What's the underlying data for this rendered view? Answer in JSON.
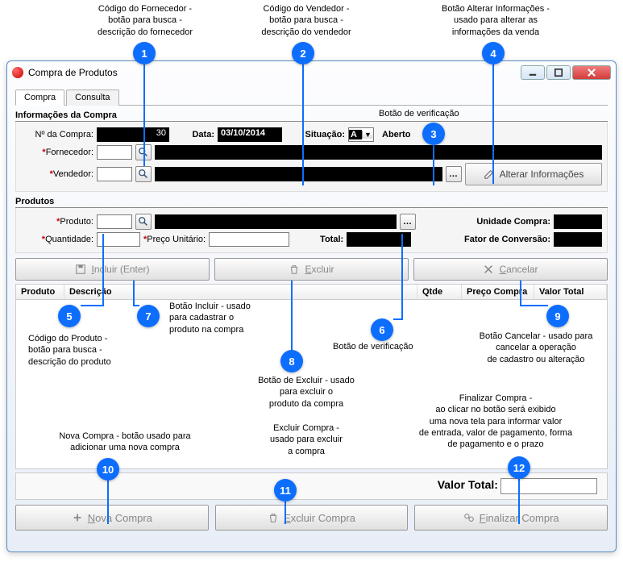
{
  "annotations": {
    "a1": {
      "num": "1",
      "text": "Código do Fornecedor -\nbotão para busca -\ndescrição do fornecedor"
    },
    "a2": {
      "num": "2",
      "text": "Código do Vendedor -\nbotão para busca -\ndescrição do vendedor"
    },
    "a3": {
      "num": "3",
      "text": "Botão de verificação"
    },
    "a4": {
      "num": "4",
      "text": "Botão Alterar Informações -\nusado para alterar as\ninformações da venda"
    },
    "a5": {
      "num": "5",
      "text": "Código do Produto -\nbotão para busca -\ndescrição do produto"
    },
    "a6": {
      "num": "6",
      "text": "Botão de verificação"
    },
    "a7": {
      "num": "7",
      "text": "Botão Incluir - usado\npara cadastrar o\nproduto na compra"
    },
    "a8": {
      "num": "8",
      "text": "Botão de Excluir - usado\npara excluir o\nproduto da compra"
    },
    "a9": {
      "num": "9",
      "text": "Botão Cancelar - usado para\ncancelar a operação\nde cadastro ou alteração"
    },
    "a10": {
      "num": "10",
      "text": "Nova Compra - botão usado para\nadicionar uma nova compra"
    },
    "a11": {
      "num": "11",
      "text": "Excluir Compra -\nusado para excluir\na compra"
    },
    "a12": {
      "num": "12",
      "text": "Finalizar Compra -\nao clicar no botão  será exibido\numa nova tela para informar valor\nde entrada, valor de pagamento, forma\nde pagamento e o prazo"
    }
  },
  "window": {
    "title": "Compra de Produtos"
  },
  "tabs": {
    "compra": "Compra",
    "consulta": "Consulta"
  },
  "info_section": {
    "title": "Informações da Compra",
    "num_compra_label": "Nº da Compra:",
    "num_compra_value": "30",
    "data_label": "Data:",
    "data_value": "03/10/2014",
    "situacao_label": "Situação:",
    "situacao_value": "A",
    "situacao_text": "Aberto",
    "fornecedor_label": "Fornecedor:",
    "vendedor_label": "Vendedor:",
    "alterar_btn": "Alterar Informações"
  },
  "produtos_section": {
    "title": "Produtos",
    "produto_label": "Produto:",
    "unidade_label": "Unidade Compra:",
    "quantidade_label": "Quantidade:",
    "preco_label": "Preço Unitário:",
    "total_label": "Total:",
    "fator_label": "Fator de Conversão:",
    "incluir_btn": "Incluir (Enter)",
    "excluir_btn": "Excluir",
    "cancelar_btn": "Cancelar"
  },
  "table": {
    "col_produto": "Produto",
    "col_descricao": "Descrição",
    "col_qtde": "Qtde",
    "col_preco": "Preço Compra",
    "col_valor": "Valor Total"
  },
  "footer": {
    "valor_total_label": "Valor Total:",
    "nova_compra_btn": "Nova Compra",
    "excluir_compra_btn": "Excluir Compra",
    "finalizar_compra_btn": "Finalizar Compra"
  }
}
